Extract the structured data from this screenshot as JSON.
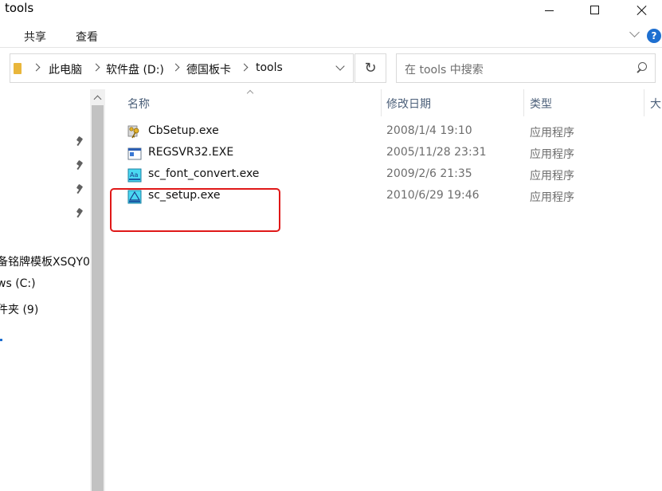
{
  "window": {
    "title": "tools"
  },
  "ribbon": {
    "tabs": [
      "共享",
      "查看"
    ]
  },
  "address": {
    "crumbs": [
      "此电脑",
      "软件盘 (D:)",
      "德国板卡",
      "tools"
    ]
  },
  "search": {
    "placeholder": "在 tools 中搜索"
  },
  "nav": {
    "items": [
      "备铭牌模板XSQY0",
      "ws (C:)",
      "件夹 (9)"
    ]
  },
  "columns": {
    "name": "名称",
    "date": "修改日期",
    "type": "类型",
    "size": "大"
  },
  "files": [
    {
      "name": "CbSetup.exe",
      "date": "2008/1/4 19:10",
      "type": "应用程序",
      "icon": "setup-key-icon"
    },
    {
      "name": "REGSVR32.EXE",
      "date": "2005/11/28 23:31",
      "type": "应用程序",
      "icon": "window-app-icon"
    },
    {
      "name": "sc_font_convert.exe",
      "date": "2009/2/6 21:35",
      "type": "应用程序",
      "icon": "font-app-icon"
    },
    {
      "name": "sc_setup.exe",
      "date": "2010/6/29 19:46",
      "type": "应用程序",
      "icon": "setup-app-icon"
    }
  ],
  "colors": {
    "accent": "#1e6fd0",
    "highlight_box": "#e01818",
    "header_text": "#4c607a"
  }
}
